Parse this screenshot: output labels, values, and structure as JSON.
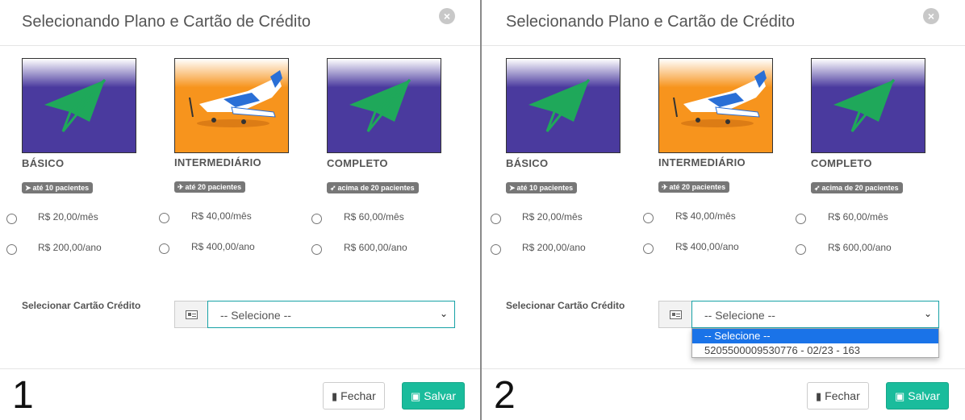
{
  "panels": [
    {
      "title": "Selecionando Plano e Cartão de Crédito",
      "close_glyph": "×",
      "step_number": "1",
      "plans": [
        {
          "name": "BÁSICO",
          "badge": "até 10 pacientes",
          "badge_icon": "paper-plane-icon",
          "monthly": "R$ 20,00/mês",
          "yearly": "R$ 200,00/ano",
          "image": "paper-plane-image"
        },
        {
          "name": "INTERMEDIÁRIO",
          "badge": "até 20 pacientes",
          "badge_icon": "plane-icon",
          "monthly": "R$ 40,00/mês",
          "yearly": "R$ 400,00/ano",
          "image": "airplane-image"
        },
        {
          "name": "COMPLETO",
          "badge": "acima de 20 pacientes",
          "badge_icon": "rocket-icon",
          "monthly": "R$ 60,00/mês",
          "yearly": "R$ 600,00/ano",
          "image": "paper-plane-image"
        }
      ],
      "card_label": "Selecionar Cartão Crédito",
      "card_select_value": "-- Selecione --",
      "dropdown_open": false,
      "buttons": {
        "close": "Fechar",
        "save": "Salvar"
      }
    },
    {
      "title": "Selecionando Plano e Cartão de Crédito",
      "close_glyph": "×",
      "step_number": "2",
      "plans": [
        {
          "name": "BÁSICO",
          "badge": "até 10 pacientes",
          "badge_icon": "paper-plane-icon",
          "monthly": "R$ 20,00/mês",
          "yearly": "R$ 200,00/ano",
          "image": "paper-plane-image"
        },
        {
          "name": "INTERMEDIÁRIO",
          "badge": "até 20 pacientes",
          "badge_icon": "plane-icon",
          "monthly": "R$ 40,00/mês",
          "yearly": "R$ 400,00/ano",
          "image": "airplane-image"
        },
        {
          "name": "COMPLETO",
          "badge": "acima de 20 pacientes",
          "badge_icon": "rocket-icon",
          "monthly": "R$ 60,00/mês",
          "yearly": "R$ 600,00/ano",
          "image": "paper-plane-image"
        }
      ],
      "card_label": "Selecionar Cartão Crédito",
      "card_select_value": "-- Selecione --",
      "dropdown_open": true,
      "dropdown_options": [
        "-- Selecione --",
        "5205500009530776 - 02/23 - 163"
      ],
      "buttons": {
        "close": "Fechar",
        "save": "Salvar"
      }
    }
  ],
  "colors": {
    "plan_purple": "#4a3a9e",
    "plan_orange": "#f7941d",
    "plane_green": "#1fa85a",
    "save_button": "#1abc9c",
    "select_border": "#17a2a6",
    "dropdown_highlight": "#1a73e8"
  }
}
